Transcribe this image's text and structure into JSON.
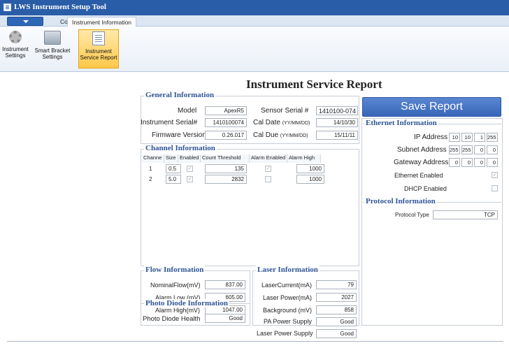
{
  "window": {
    "title": "LWS Instrument Setup Tool"
  },
  "tabs": {
    "connect": "Connect",
    "info": "Instrument Information"
  },
  "ribbon": {
    "instrument_settings": [
      "Instrument",
      "Settings"
    ],
    "smart_bracket": [
      "Smart Bracket",
      "Settings"
    ],
    "service_report": [
      "Instrument",
      "Service Report"
    ]
  },
  "report": {
    "title": "Instrument Service Report",
    "save_label": "Save Report"
  },
  "general": {
    "title": "General Information",
    "model_label": "Model",
    "model": "ApexR5",
    "sensor_serial_label": "Sensor Serial #",
    "sensor_serial": "1410100-074",
    "inst_serial_label": "Instrument Serial#",
    "inst_serial": "1410100074",
    "cal_date_label": "Cal Date",
    "cal_date_fmt": "(YY/MM/DD)",
    "cal_date": "14/10/30",
    "firmware_label": "Firmware Version",
    "firmware": "0.26.017",
    "cal_due_label": "Cal Due",
    "cal_due_fmt": "(YY/MM/DD)",
    "cal_due": "15/11/11"
  },
  "channel": {
    "title": "Channel Information",
    "headers": [
      "Channe",
      "Size",
      "Enabled",
      "Count Threshold",
      "Alarm Enabled",
      "Alarm High"
    ],
    "rows": [
      {
        "channel": "1",
        "size": "0.5",
        "enabled": true,
        "threshold": "135",
        "alarm_enabled": true,
        "alarm_high": "1000"
      },
      {
        "channel": "2",
        "size": "5.0",
        "enabled": true,
        "threshold": "2832",
        "alarm_enabled": false,
        "alarm_high": "1000"
      }
    ]
  },
  "ethernet": {
    "title": "Ethernet Information",
    "ip_label": "IP Address",
    "ip": [
      "10",
      "10",
      "1",
      "255"
    ],
    "subnet_label": "Subnet Address",
    "subnet": [
      "255",
      "255",
      "0",
      "0"
    ],
    "gateway_label": "Gateway Address",
    "gateway": [
      "0",
      "0",
      "0",
      "0"
    ],
    "enabled_label": "Ethernet Enabled",
    "enabled": true,
    "dhcp_label": "DHCP Enabled",
    "dhcp": false
  },
  "protocol": {
    "title": "Protocol Information",
    "type_label": "Protocol Type",
    "type": "TCP"
  },
  "flow": {
    "title": "Flow Information",
    "nominal_label": "NominalFlow(mV)",
    "nominal": "837.00",
    "alarm_low_label": "Alarm Low (mV)",
    "alarm_low": "605.00",
    "alarm_high_label": "Alarm High(mV)",
    "alarm_high": "1047.00"
  },
  "photo": {
    "title": "Photo Diode Information",
    "health_label": "Photo Diode Health",
    "health": "Good"
  },
  "laser": {
    "title": "Laser Information",
    "current_label": "LaserCurrent(mA)",
    "current": "79",
    "power_label": "Laser Power(mA)",
    "power": "2027",
    "background_label": "Background (mV)",
    "background": "858",
    "pa_label": "PA Power Supply",
    "pa": "Good",
    "lps_label": "Laser Power Supply",
    "lps": "Good"
  },
  "colors": {
    "accent": "#2a5da8",
    "group_title": "#2f5597",
    "active_tab": "#ffc94a"
  }
}
